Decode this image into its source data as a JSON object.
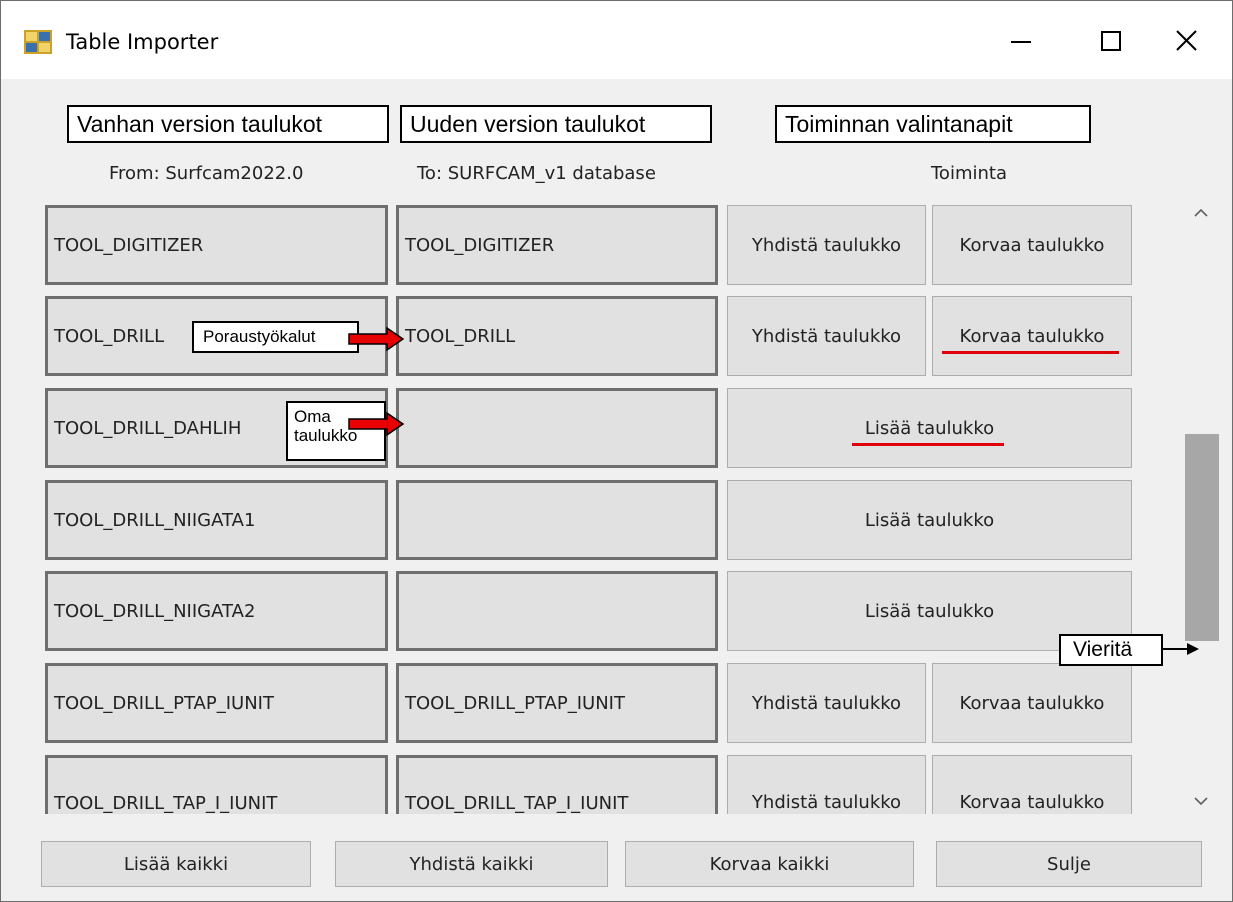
{
  "window": {
    "title": "Table Importer"
  },
  "annotations": {
    "old_tables": "Vanhan version taulukot",
    "new_tables": "Uuden version taulukot",
    "action_buttons": "Toiminnan valintanapit",
    "drill_tools": "Poraustyökalut",
    "own_table_line1": "Oma",
    "own_table_line2": "taulukko",
    "scroll": "Vieritä"
  },
  "columns": {
    "from": "From: Surfcam2022.0",
    "to": "To: SURFCAM_v1 database",
    "action": "Toiminta"
  },
  "rows": [
    {
      "source": "TOOL_DIGITIZER",
      "target": "TOOL_DIGITIZER",
      "merge": "Yhdistä taulukko",
      "replace": "Korvaa taulukko"
    },
    {
      "source": "TOOL_DRILL",
      "target": "TOOL_DRILL",
      "merge": "Yhdistä taulukko",
      "replace": "Korvaa taulukko"
    },
    {
      "source": "TOOL_DRILL_DAHLIH",
      "target": "",
      "add": "Lisää taulukko"
    },
    {
      "source": "TOOL_DRILL_NIIGATA1",
      "target": "",
      "add": "Lisää taulukko"
    },
    {
      "source": "TOOL_DRILL_NIIGATA2",
      "target": "",
      "add": "Lisää taulukko"
    },
    {
      "source": "TOOL_DRILL_PTAP_IUNIT",
      "target": "TOOL_DRILL_PTAP_IUNIT",
      "merge": "Yhdistä taulukko",
      "replace": "Korvaa taulukko"
    },
    {
      "source": "TOOL_DRILL_TAP_I_IUNIT",
      "target": "TOOL_DRILL_TAP_I_IUNIT",
      "merge": "Yhdistä taulukko",
      "replace": "Korvaa taulukko"
    }
  ],
  "footer": {
    "add_all": "Lisää kaikki",
    "merge_all": "Yhdistä kaikki",
    "replace_all": "Korvaa kaikki",
    "close": "Sulje"
  },
  "colors": {
    "highlight": "#e0000b",
    "arrow": "#e60000"
  }
}
